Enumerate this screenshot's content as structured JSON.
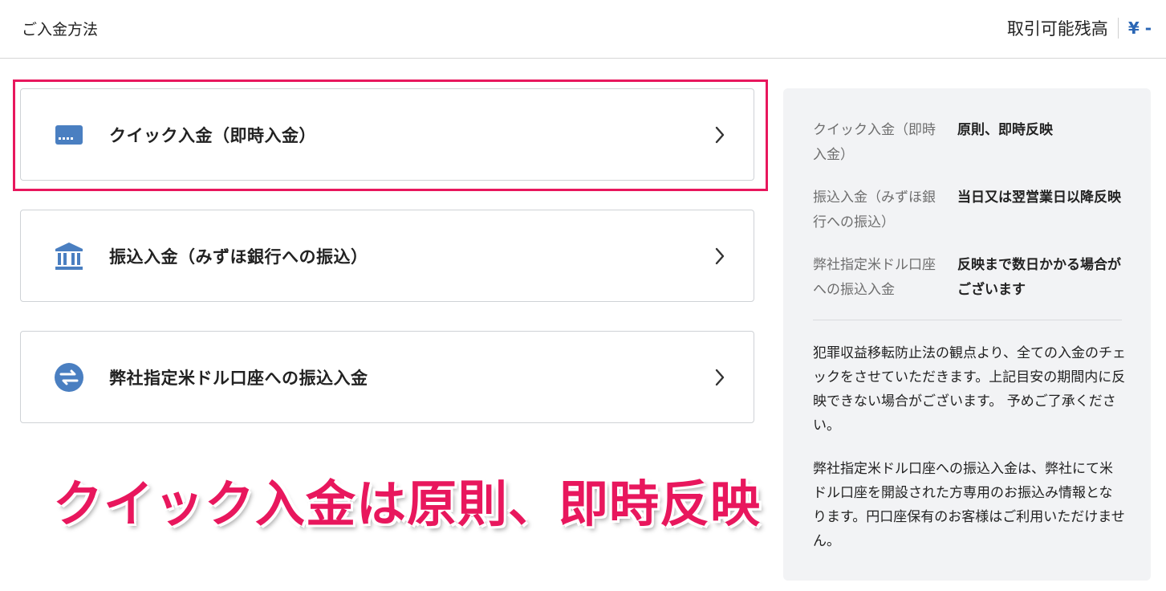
{
  "header": {
    "title": "ご入金方法",
    "balance_label": "取引可能残高",
    "balance_value": "¥ -"
  },
  "methods": [
    {
      "label": "クイック入金（即時入金）",
      "icon": "credit-card-icon"
    },
    {
      "label": "振込入金（みずほ銀行への振込）",
      "icon": "bank-icon"
    },
    {
      "label": "弊社指定米ドル口座への振込入金",
      "icon": "transfer-arrows-icon"
    }
  ],
  "annotation": "クイック入金は原則、即時反映",
  "info": {
    "rows": [
      {
        "key": "クイック入金（即時入金）",
        "value": "原則、即時反映"
      },
      {
        "key": "振込入金（みずほ銀行への振込）",
        "value": "当日又は翌営業日以降反映"
      },
      {
        "key": "弊社指定米ドル口座への振込入金",
        "value": "反映まで数日かかる場合がございます"
      }
    ],
    "note1": "犯罪収益移転防止法の観点より、全ての入金のチェックをさせていただきます。上記目安の期間内に反映できない場合がございます。 予めご了承ください。",
    "note2": "弊社指定米ドル口座への振込入金は、弊社にて米ドル口座を開設された方専用のお振込み情報となります。円口座保有のお客様はご利用いただけません。"
  },
  "colors": {
    "accent": "#e8175d",
    "icon_blue": "#4a7fc1",
    "balance_blue": "#2a66b5",
    "panel_bg": "#f2f3f5"
  }
}
